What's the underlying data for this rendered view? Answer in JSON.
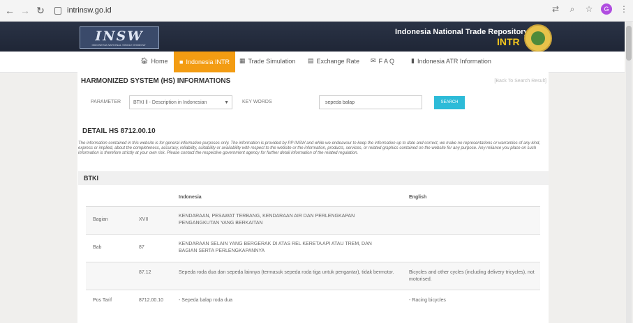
{
  "browser": {
    "url": "intrinsw.go.id"
  },
  "header": {
    "logo_text": "INSW",
    "logo_sub": "INDONESIA NATIONAL SINGLE WINDOW",
    "repo_title": "Indonesia National Trade Repository",
    "repo_abbrev": "INTR"
  },
  "menu": [
    {
      "label": "Home",
      "icon": "home-icon",
      "glyph": "🏠︎"
    },
    {
      "label": "Indonesia INTR",
      "icon": "square-icon",
      "glyph": "■"
    },
    {
      "label": "Trade Simulation",
      "icon": "table-icon",
      "glyph": "▦"
    },
    {
      "label": "Exchange Rate",
      "icon": "table-icon",
      "glyph": "▤"
    },
    {
      "label": "F A Q",
      "icon": "chat-icon",
      "glyph": "✉"
    },
    {
      "label": "Indonesia ATR Information",
      "icon": "book-icon",
      "glyph": "▮"
    }
  ],
  "page": {
    "title": "HARMONIZED SYSTEM (HS) INFORMATIONS",
    "back_link": "[Back To Search Result]",
    "parameter_label": "PARAMETER",
    "parameter_value": "BTKI ll - Description in Indonesian",
    "keywords_label": "KEY WORDS",
    "keywords_value": "sepeda balap",
    "search_label": "SEARCH",
    "detail_title": "DETAIL HS 8712.00.10",
    "disclaimer": "The information contained in this website is for general information purposes only. The information is provided by PP INSW and while we endeavour to keep the information up to date and correct, we make no representations or warranties of any kind, express or implied, about the completeness, accuracy, reliability, suitability or availability with respect to the website or the information, products, services, or related graphics contained on the website for any purpose. Any reliance you place on such information is therefore strictly at your own risk. Please contact the respective government agency for further detail information of the related regulation.",
    "section_title": "BTKI"
  },
  "table": {
    "headers": [
      "Indonesia",
      "English"
    ],
    "rows": [
      {
        "label": "Bagian",
        "code": "XVII",
        "indonesia": "KENDARAAN, PESAWAT TERBANG, KENDARAAN AIR DAN PERLENGKAPAN PENGANGKUTAN YANG BERKAITAN",
        "english": ""
      },
      {
        "label": "Bab",
        "code": "87",
        "indonesia": "KENDARAAN SELAIN YANG BERGERAK DI ATAS REL KERETA API ATAU TREM, DAN BAGIAN SERTA PERLENGKAPANNYA",
        "english": ""
      },
      {
        "label": "",
        "code": "87.12",
        "indonesia": "Sepeda roda dua dan sepeda lainnya (termasuk sepeda roda tiga untuk pengantar), tidak bermotor.",
        "english": "Bicycles and other cycles (including delivery tricycles), not motorised."
      },
      {
        "label": "Pos Tarif",
        "code": "8712.00.10",
        "indonesia": "- Sepeda balap roda dua",
        "english": "- Racing bicycles"
      }
    ]
  }
}
